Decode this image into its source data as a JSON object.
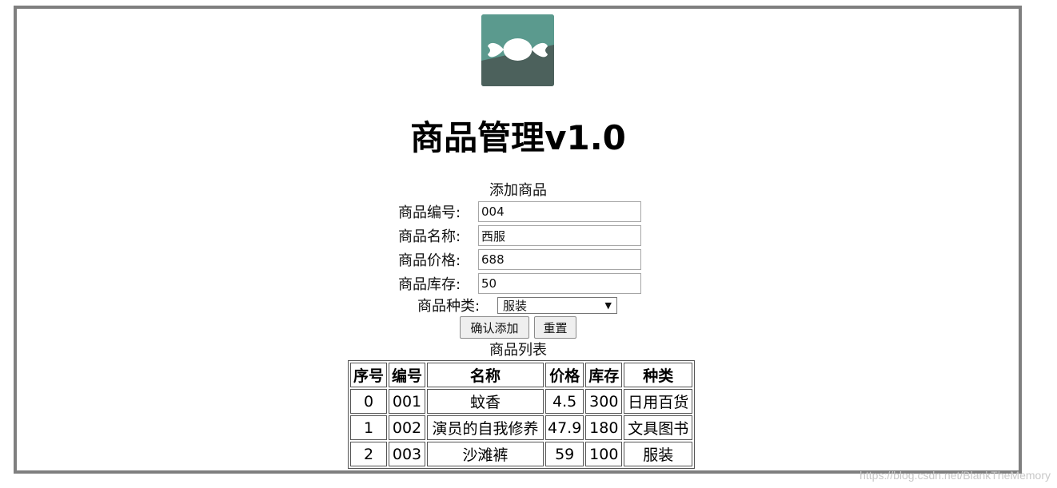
{
  "app": {
    "title": "商品管理v1.0",
    "logo_icon": "candy-icon",
    "logo_color": "#5b9a8e"
  },
  "add_form": {
    "section_title": "添加商品",
    "fields": [
      {
        "label": "商品编号:",
        "value": "004"
      },
      {
        "label": "商品名称:",
        "value": "西服"
      },
      {
        "label": "商品价格:",
        "value": "688"
      },
      {
        "label": "商品库存:",
        "value": "50"
      }
    ],
    "category": {
      "label": "商品种类:",
      "selected": "服装"
    },
    "submit_label": "确认添加",
    "reset_label": "重置"
  },
  "list": {
    "section_title": "商品列表",
    "columns": [
      "序号",
      "编号",
      "名称",
      "价格",
      "库存",
      "种类"
    ],
    "rows": [
      [
        "0",
        "001",
        "蚊香",
        "4.5",
        "300",
        "日用百货"
      ],
      [
        "1",
        "002",
        "演员的自我修养",
        "47.9",
        "180",
        "文具图书"
      ],
      [
        "2",
        "003",
        "沙滩裤",
        "59",
        "100",
        "服装"
      ]
    ]
  },
  "watermark": "https://blog.csdn.net/BlankTheMemory"
}
